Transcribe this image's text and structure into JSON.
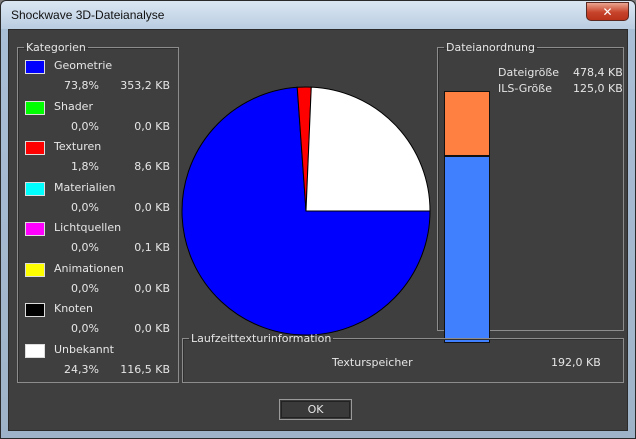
{
  "window": {
    "title": "Shockwave 3D-Dateianalyse",
    "close_glyph": "✕"
  },
  "categories": {
    "legend": "Kategorien",
    "items": [
      {
        "name": "Geometrie",
        "percent": "73,8%",
        "size": "353,2 KB",
        "color": "#0000ff"
      },
      {
        "name": "Shader",
        "percent": "0,0%",
        "size": "0,0 KB",
        "color": "#00ff00"
      },
      {
        "name": "Texturen",
        "percent": "1,8%",
        "size": "8,6 KB",
        "color": "#ff0000"
      },
      {
        "name": "Materialien",
        "percent": "0,0%",
        "size": "0,0 KB",
        "color": "#00ffff"
      },
      {
        "name": "Lichtquellen",
        "percent": "0,0%",
        "size": "0,1 KB",
        "color": "#ff00ff"
      },
      {
        "name": "Animationen",
        "percent": "0,0%",
        "size": "0,0 KB",
        "color": "#ffff00"
      },
      {
        "name": "Knoten",
        "percent": "0,0%",
        "size": "0,0 KB",
        "color": "#000000"
      },
      {
        "name": "Unbekannt",
        "percent": "24,3%",
        "size": "116,5 KB",
        "color": "#ffffff"
      }
    ]
  },
  "chart_data": {
    "type": "pie",
    "values": [
      73.8,
      0.0,
      1.8,
      0.0,
      0.0,
      0.0,
      0.0,
      24.3
    ],
    "colors": [
      "#0000ff",
      "#00ff00",
      "#ff0000",
      "#00ffff",
      "#ff00ff",
      "#ffff00",
      "#000000",
      "#ffffff"
    ]
  },
  "file_layout": {
    "legend": "Dateianordnung",
    "file_size_label": "Dateigröße",
    "file_size_value": "478,4 KB",
    "ils_size_label": "ILS-Größe",
    "ils_size_value": "125,0 KB",
    "ils_kb": 125.0,
    "file_kb": 478.4,
    "ils_color": "#ff8040",
    "file_color": "#4080ff"
  },
  "runtime": {
    "legend": "Laufzeittexturinformation",
    "texture_memory_label": "Texturspeicher",
    "texture_memory_value": "192,0 KB"
  },
  "buttons": {
    "ok_label": "OK"
  }
}
